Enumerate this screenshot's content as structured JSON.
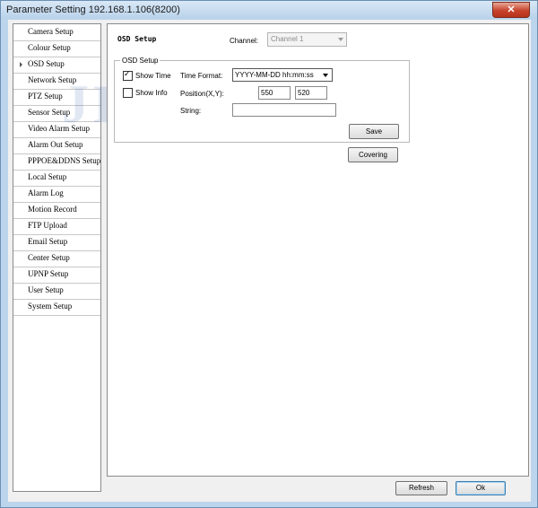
{
  "window": {
    "title": "Parameter Setting 192.168.1.106(8200)",
    "close_glyph": "✕"
  },
  "sidebar": {
    "items": [
      {
        "label": "Camera Setup"
      },
      {
        "label": "Colour Setup"
      },
      {
        "label": "OSD Setup",
        "active": true
      },
      {
        "label": "Network Setup"
      },
      {
        "label": "PTZ Setup"
      },
      {
        "label": "Sensor Setup"
      },
      {
        "label": "Video Alarm Setup"
      },
      {
        "label": "Alarm Out Setup"
      },
      {
        "label": "PPPOE&DDNS Setup"
      },
      {
        "label": "Local Setup"
      },
      {
        "label": "Alarm Log"
      },
      {
        "label": "Motion Record"
      },
      {
        "label": "FTP Upload"
      },
      {
        "label": "Email Setup"
      },
      {
        "label": "Center Setup"
      },
      {
        "label": "UPNP Setup"
      },
      {
        "label": "User Setup"
      },
      {
        "label": "System Setup"
      }
    ]
  },
  "panel": {
    "title": "OSD Setup",
    "channel_label": "Channel:",
    "channel_value": "Channel 1",
    "group_legend": "OSD Setup",
    "show_time_label": "Show Time",
    "show_time_checked": true,
    "show_info_label": "Show Info",
    "show_info_checked": false,
    "time_format_label": "Time Format:",
    "time_format_value": "YYYY-MM-DD hh:mm:ss",
    "position_label": "Position(X,Y):",
    "position_x": "550",
    "position_y": "520",
    "string_label": "String:",
    "string_value": "",
    "save_label": "Save",
    "covering_label": "Covering"
  },
  "footer": {
    "refresh_label": "Refresh",
    "ok_label": "Ok"
  },
  "watermark": {
    "text": "JIENU",
    "registered": "®"
  },
  "colors": {
    "frame": "#bcd5ec",
    "close": "#c7432b",
    "watermark": "#466eb4"
  }
}
